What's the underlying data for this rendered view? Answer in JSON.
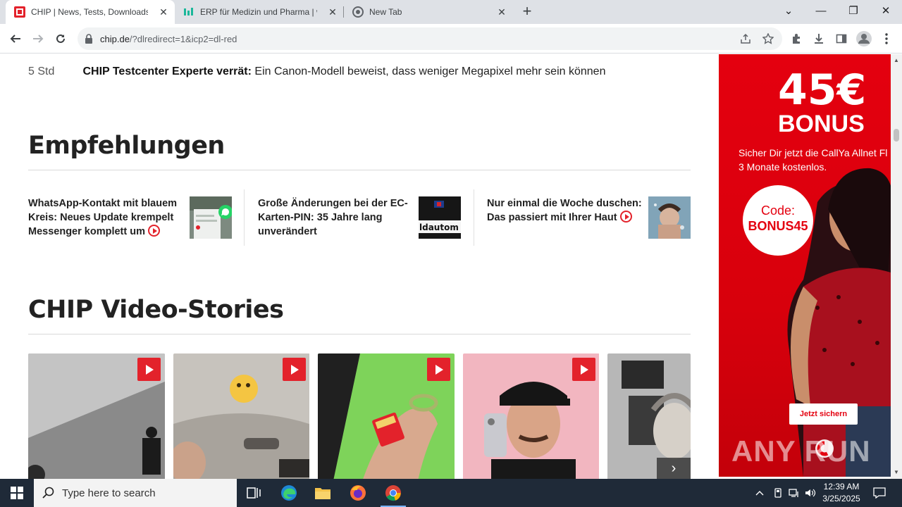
{
  "browser": {
    "tabs": [
      {
        "title": "CHIP | News, Tests, Downloads, T",
        "close": "✕"
      },
      {
        "title": "ERP für Medizin und Pharma | w",
        "close": "✕"
      },
      {
        "title": "New Tab",
        "close": "✕"
      }
    ],
    "new_tab": "+",
    "window_controls": {
      "dropdown": "⌄",
      "minimize": "—",
      "restore": "❐",
      "close": "✕"
    },
    "url_host": "chip.de",
    "url_path": "/?dlredirect=1&icp2=dl-red"
  },
  "page": {
    "news_row": {
      "time": "5 Std",
      "kicker": "CHIP Testcenter Experte verrät:",
      "headline": "Ein Canon-Modell beweist, dass weniger Megapixel mehr sein können"
    },
    "recommendations_title": "Empfehlungen",
    "recommendations": [
      {
        "text": "WhatsApp-Kontakt mit blauem Kreis: Neues Update krempelt Messenger komplett um",
        "has_video": true
      },
      {
        "text": "Große Änderungen bei der EC-Karten-PIN: 35 Jahre lang unverändert",
        "has_video": false,
        "thumb_text": "ldautom"
      },
      {
        "text": "Nur einmal die Woche duschen: Das passiert mit Ihrer Haut",
        "has_video": true
      }
    ],
    "video_stories_title": "CHIP Video-Stories",
    "next_arrow": "›"
  },
  "ad": {
    "amount": "45€",
    "bonus": "BONUS",
    "sub_line1": "Sicher Dir jetzt die CallYa Allnet Fl",
    "sub_line2": "3 Monate kostenlos.",
    "code_label": "Code:",
    "code_value": "BONUS45",
    "cta": "Jetzt sichern",
    "watermark": "ANY RUN"
  },
  "taskbar": {
    "search_placeholder": "Type here to search",
    "time": "12:39 AM",
    "date": "3/25/2025"
  },
  "colors": {
    "chip_red": "#e3222b",
    "vodafone_red": "#e4000f",
    "taskbar": "#1f2a38"
  }
}
